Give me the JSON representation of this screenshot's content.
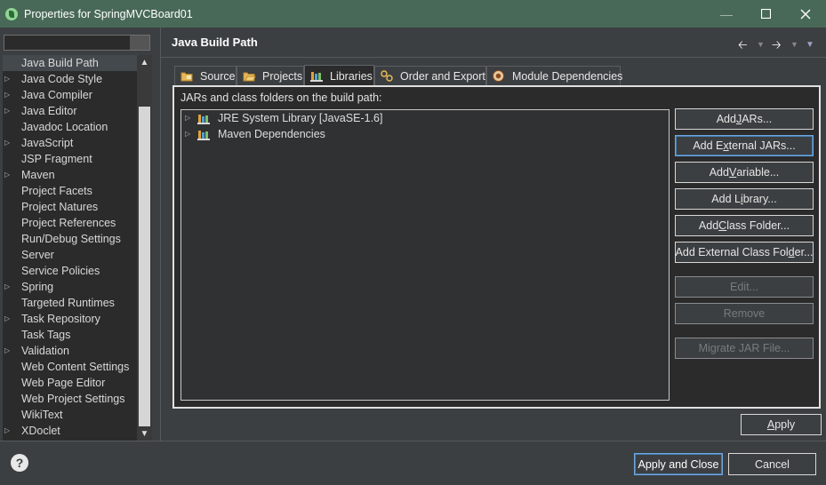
{
  "window": {
    "title": "Properties for SpringMVCBoard01"
  },
  "colors": {
    "titlebar": "#496958",
    "background": "#3c3f41",
    "panel": "#2b2b2b",
    "focus_border": "#6ea6de"
  },
  "nav": {
    "filter_value": "",
    "items": [
      {
        "label": "Java Build Path",
        "expandable": false,
        "selected": true
      },
      {
        "label": "Java Code Style",
        "expandable": true
      },
      {
        "label": "Java Compiler",
        "expandable": true
      },
      {
        "label": "Java Editor",
        "expandable": true
      },
      {
        "label": "Javadoc Location",
        "expandable": false
      },
      {
        "label": "JavaScript",
        "expandable": true
      },
      {
        "label": "JSP Fragment",
        "expandable": false
      },
      {
        "label": "Maven",
        "expandable": true
      },
      {
        "label": "Project Facets",
        "expandable": false
      },
      {
        "label": "Project Natures",
        "expandable": false
      },
      {
        "label": "Project References",
        "expandable": false
      },
      {
        "label": "Run/Debug Settings",
        "expandable": false
      },
      {
        "label": "Server",
        "expandable": false
      },
      {
        "label": "Service Policies",
        "expandable": false
      },
      {
        "label": "Spring",
        "expandable": true
      },
      {
        "label": "Targeted Runtimes",
        "expandable": false
      },
      {
        "label": "Task Repository",
        "expandable": true
      },
      {
        "label": "Task Tags",
        "expandable": false
      },
      {
        "label": "Validation",
        "expandable": true
      },
      {
        "label": "Web Content Settings",
        "expandable": false
      },
      {
        "label": "Web Page Editor",
        "expandable": false
      },
      {
        "label": "Web Project Settings",
        "expandable": false
      },
      {
        "label": "WikiText",
        "expandable": false
      },
      {
        "label": "XDoclet",
        "expandable": true
      }
    ]
  },
  "header": {
    "title": "Java Build Path"
  },
  "tabs": [
    {
      "label": "Source",
      "icon": "source-folder-icon"
    },
    {
      "label": "Projects",
      "icon": "projects-folder-icon"
    },
    {
      "label": "Libraries",
      "icon": "libraries-icon",
      "active": true
    },
    {
      "label": "Order and Export",
      "icon": "order-export-icon"
    },
    {
      "label": "Module Dependencies",
      "icon": "module-dependencies-icon"
    }
  ],
  "libraries": {
    "description": "JARs and class folders on the build path:",
    "entries": [
      {
        "label": "JRE System Library [JavaSE-1.6]"
      },
      {
        "label": "Maven Dependencies"
      }
    ]
  },
  "buttons": {
    "add_jars": {
      "pre": "Add ",
      "key": "J",
      "post": "ARs..."
    },
    "add_external_jars": {
      "pre": "Add E",
      "key": "x",
      "post": "ternal JARs..."
    },
    "add_variable": {
      "pre": "Add ",
      "key": "V",
      "post": "ariable..."
    },
    "add_library": {
      "pre": "Add L",
      "key": "i",
      "post": "brary..."
    },
    "add_class_folder": {
      "pre": "Add ",
      "key": "C",
      "post": "lass Folder..."
    },
    "add_external_class_folder": {
      "pre": "Add External Class Fol",
      "key": "d",
      "post": "er..."
    },
    "edit": "Edit...",
    "remove": "Remove",
    "migrate": "Migrate JAR File..."
  },
  "apply": {
    "pre": "",
    "key": "A",
    "post": "pply"
  },
  "footer": {
    "apply_close": "Apply and Close",
    "cancel": "Cancel"
  }
}
